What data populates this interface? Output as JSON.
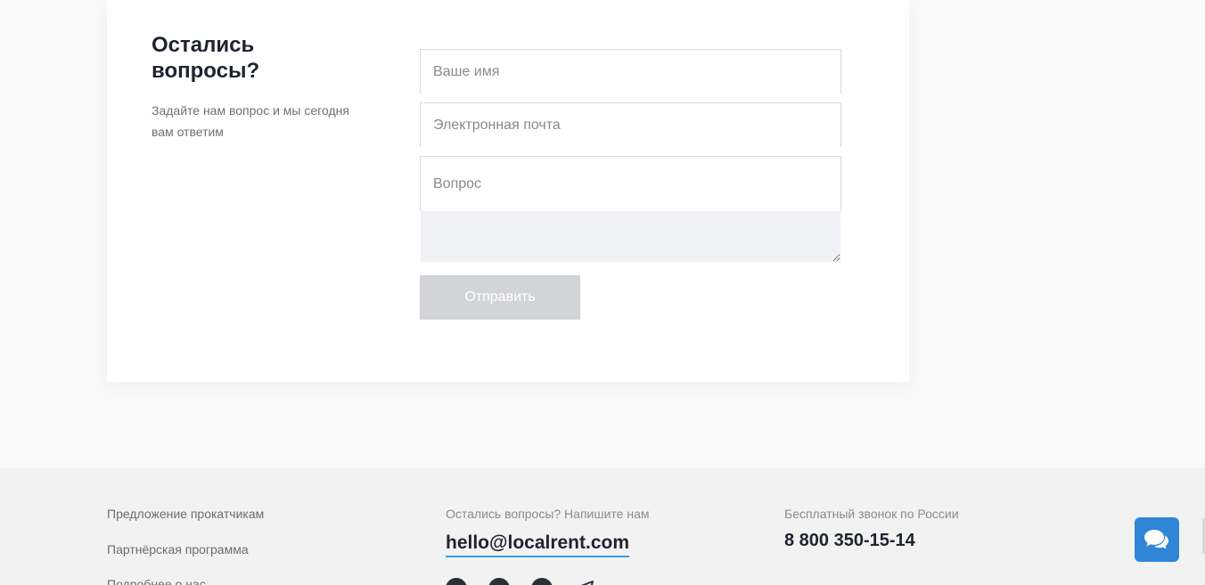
{
  "question_form": {
    "title": "Остались вопросы?",
    "subtitle": "Задайте нам вопрос и мы сегодня вам ответим",
    "name_placeholder": "Ваше имя",
    "email_placeholder": "Электронная почта",
    "question_label": "Вопрос",
    "submit_label": "Отправить"
  },
  "footer": {
    "links": [
      {
        "label": "Предложение прокатчикам"
      },
      {
        "label": "Партнёрская программа"
      },
      {
        "label": "Подробнее о нас"
      }
    ],
    "mail_caption": "Остались вопросы? Напишите нам",
    "email": "hello@localrent.com",
    "phone_caption": "Бесплатный звонок по России",
    "phone": "8 800 350-15-14",
    "social_icons": [
      "facebook-icon",
      "skype-icon",
      "vk-icon",
      "telegram-icon"
    ]
  },
  "chat_widget": {
    "icon": "chat-bubbles-icon"
  },
  "colors": {
    "accent": "#2f86d6",
    "email_underline": "#3aa0d8",
    "button_disabled": "#d3d4d8",
    "heading": "#1f2330"
  }
}
